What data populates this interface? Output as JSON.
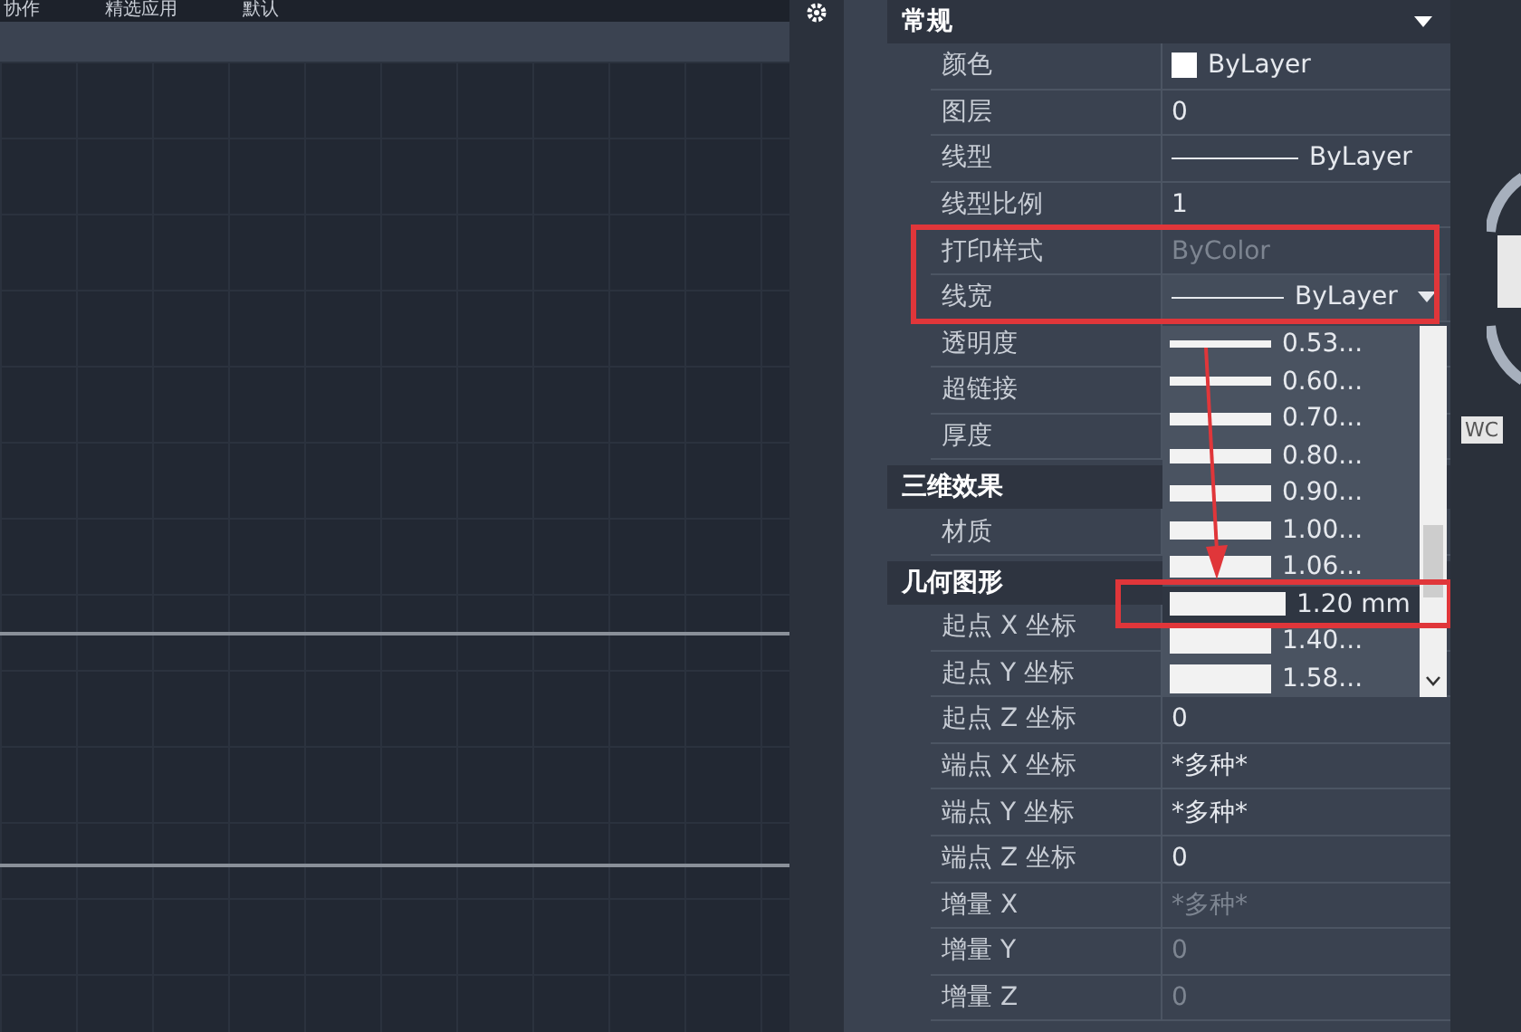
{
  "ribbon_tabs": [
    "协作",
    "精选应用",
    "默认"
  ],
  "properties": {
    "sections": [
      {
        "title": "常规",
        "rows": [
          {
            "label": "颜色",
            "value": "ByLayer",
            "kind": "color",
            "disabled": false
          },
          {
            "label": "图层",
            "value": "0",
            "kind": "text",
            "disabled": false
          },
          {
            "label": "线型",
            "value": "ByLayer",
            "kind": "linetype",
            "disabled": false
          },
          {
            "label": "线型比例",
            "value": "1",
            "kind": "text",
            "disabled": false
          },
          {
            "label": "打印样式",
            "value": "ByColor",
            "kind": "text",
            "disabled": true
          },
          {
            "label": "线宽",
            "value": "ByLayer",
            "kind": "dropdown",
            "disabled": false
          },
          {
            "label": "透明度",
            "kind": "text"
          },
          {
            "label": "超链接",
            "kind": "text"
          },
          {
            "label": "厚度",
            "kind": "text"
          }
        ]
      },
      {
        "title": "三维效果",
        "rows": [
          {
            "label": "材质",
            "kind": "text"
          }
        ]
      },
      {
        "title": "几何图形",
        "rows": [
          {
            "label": "起点 X 坐标",
            "kind": "text"
          },
          {
            "label": "起点 Y 坐标",
            "kind": "text"
          },
          {
            "label": "起点 Z 坐标",
            "value": "0",
            "kind": "text",
            "disabled": false
          },
          {
            "label": "端点 X 坐标",
            "value": "*多种*",
            "kind": "text",
            "disabled": false
          },
          {
            "label": "端点 Y 坐标",
            "value": "*多种*",
            "kind": "text",
            "disabled": false
          },
          {
            "label": "端点 Z 坐标",
            "value": "0",
            "kind": "text",
            "disabled": false
          },
          {
            "label": "增量 X",
            "value": "*多种*",
            "kind": "text",
            "disabled": true
          },
          {
            "label": "增量 Y",
            "value": "0",
            "kind": "text",
            "disabled": true
          },
          {
            "label": "增量 Z",
            "value": "0",
            "kind": "text",
            "disabled": true
          }
        ]
      }
    ]
  },
  "lineweight_dropdown": {
    "options": [
      {
        "label": "0.53...",
        "selected": false
      },
      {
        "label": "0.60...",
        "selected": false
      },
      {
        "label": "0.70...",
        "selected": false
      },
      {
        "label": "0.80...",
        "selected": false
      },
      {
        "label": "0.90...",
        "selected": false
      },
      {
        "label": "1.00...",
        "selected": false
      },
      {
        "label": "1.06...",
        "selected": false
      },
      {
        "label": "1.20 mm",
        "selected": true
      },
      {
        "label": "1.40...",
        "selected": false
      },
      {
        "label": "1.58...",
        "selected": false
      }
    ]
  },
  "viewcube": {
    "label": "WC"
  }
}
